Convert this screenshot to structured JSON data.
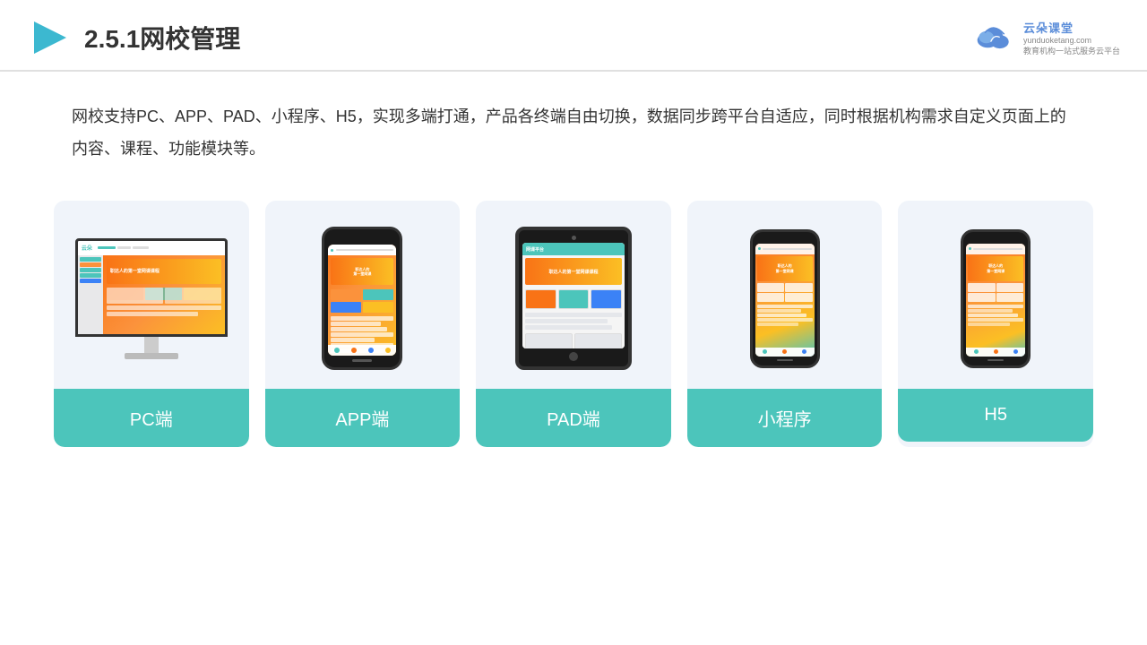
{
  "header": {
    "title": "2.5.1网校管理",
    "logo_name": "云朵课堂",
    "logo_domain": "yunduoketang.com",
    "logo_tagline": "教育机构一站\n式服务云平台"
  },
  "description": {
    "text": "网校支持PC、APP、PAD、小程序、H5，实现多端打通，产品各终端自由切换，数据同步跨平台自适应，同时根据机构需求自定义页面上的内容、课程、功能模块等。"
  },
  "cards": [
    {
      "label": "PC端",
      "type": "pc"
    },
    {
      "label": "APP端",
      "type": "phone"
    },
    {
      "label": "PAD端",
      "type": "tablet"
    },
    {
      "label": "小程序",
      "type": "phone2"
    },
    {
      "label": "H5",
      "type": "phone3"
    }
  ],
  "colors": {
    "teal": "#4cc5bb",
    "accent": "#f97316",
    "bg_card": "#eef2f9",
    "text_dark": "#333333"
  }
}
